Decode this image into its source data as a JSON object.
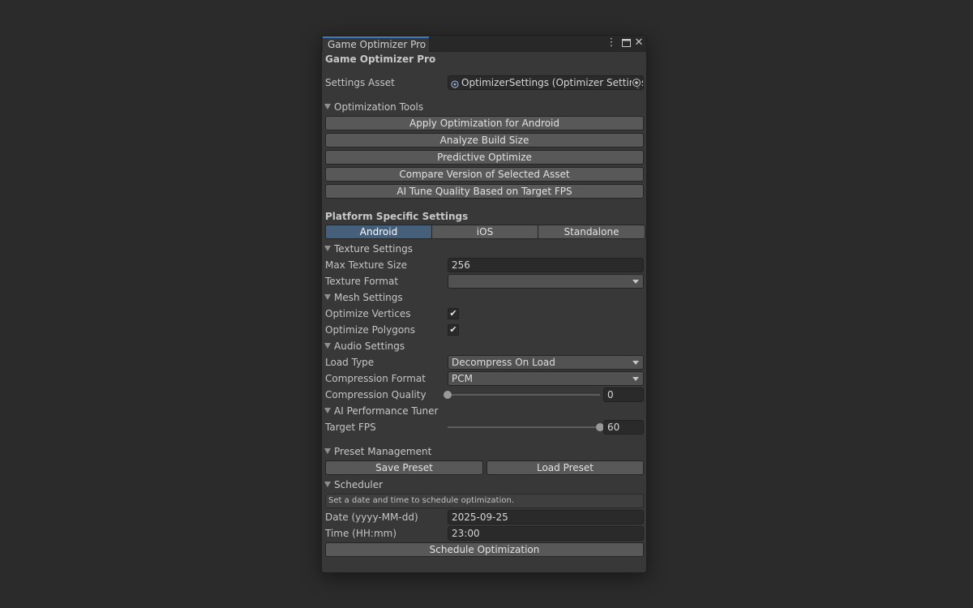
{
  "window": {
    "tab_title": "Game Optimizer Pro",
    "controls": {
      "menu": "⋮",
      "maximize": "□",
      "close": "✕"
    }
  },
  "header": {
    "title": "Game Optimizer Pro"
  },
  "settings_asset": {
    "label": "Settings Asset",
    "value": "OptimizerSettings (Optimizer Settings)"
  },
  "optimization_tools": {
    "foldout": "Optimization Tools",
    "buttons": [
      "Apply Optimization for Android",
      "Analyze Build Size",
      "Predictive Optimize",
      "Compare Version of Selected Asset",
      "AI Tune Quality Based on Target FPS"
    ]
  },
  "platform": {
    "heading": "Platform Specific Settings",
    "tabs": [
      "Android",
      "iOS",
      "Standalone"
    ],
    "selected_tab": "Android"
  },
  "texture": {
    "foldout": "Texture Settings",
    "max_size_label": "Max Texture Size",
    "max_size_value": "256",
    "format_label": "Texture Format",
    "format_value": ""
  },
  "mesh": {
    "foldout": "Mesh Settings",
    "optimize_vertices_label": "Optimize Vertices",
    "optimize_vertices_checked": true,
    "optimize_polygons_label": "Optimize Polygons",
    "optimize_polygons_checked": true,
    "check_glyph": "✔"
  },
  "audio": {
    "foldout": "Audio Settings",
    "load_type_label": "Load Type",
    "load_type_value": "Decompress On Load",
    "compression_format_label": "Compression Format",
    "compression_format_value": "PCM",
    "compression_quality_label": "Compression Quality",
    "compression_quality_value": "0",
    "compression_quality_fraction": 0.0
  },
  "ai_tuner": {
    "foldout": "AI Performance Tuner",
    "target_fps_label": "Target FPS",
    "target_fps_value": "60",
    "target_fps_fraction": 1.0
  },
  "presets": {
    "foldout": "Preset Management",
    "save_label": "Save Preset",
    "load_label": "Load Preset"
  },
  "scheduler": {
    "foldout": "Scheduler",
    "help": "Set a date and time to schedule optimization.",
    "date_label": "Date (yyyy-MM-dd)",
    "date_value": "2025-09-25",
    "time_label": "Time (HH:mm)",
    "time_value": "23:00",
    "schedule_button": "Schedule Optimization"
  },
  "colors": {
    "background": "#2b2b2b",
    "panel": "#383838",
    "accent": "#3a79bb",
    "selected_tab": "#46607c"
  }
}
